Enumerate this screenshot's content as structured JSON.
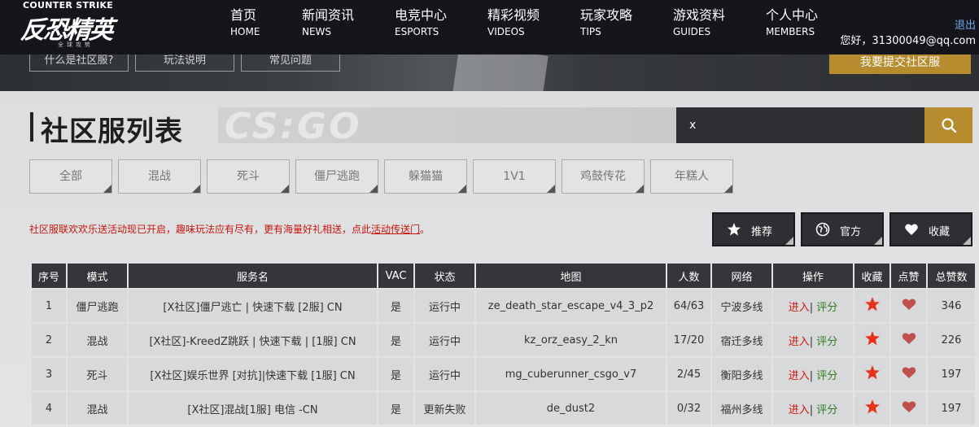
{
  "brand": {
    "en": "COUNTER STRIKE",
    "cn": "反恐精英",
    "sub": "全球攻势"
  },
  "nav": [
    {
      "cn": "首页",
      "en": "HOME"
    },
    {
      "cn": "新闻资讯",
      "en": "NEWS"
    },
    {
      "cn": "电竞中心",
      "en": "ESPORTS"
    },
    {
      "cn": "精彩视频",
      "en": "VIDEOS"
    },
    {
      "cn": "玩家攻略",
      "en": "TIPS"
    },
    {
      "cn": "游戏资料",
      "en": "GUIDES"
    },
    {
      "cn": "个人中心",
      "en": "MEMBERS"
    }
  ],
  "user": {
    "logout": "退出",
    "greeting": "您好，31300049@qq.com"
  },
  "banner": {
    "buttons": [
      "什么是社区服?",
      "玩法说明",
      "常见问题"
    ],
    "submit": "我要提交社区服"
  },
  "page": {
    "title": "社区服列表",
    "watermark": "CS:GO"
  },
  "search": {
    "value": "x"
  },
  "filters": [
    "全部",
    "混战",
    "死斗",
    "僵尸逃跑",
    "躲猫猫",
    "1V1",
    "鸡鼓传花",
    "年糕人"
  ],
  "notice": {
    "text": "社区服联欢欢乐送活动现已开启，趣味玩法应有尽有，更有海量好礼相送，点此",
    "link": "活动传送门",
    "end": "。"
  },
  "sort_buttons": [
    {
      "label": "推荐",
      "icon": "star-icon"
    },
    {
      "label": "官方",
      "icon": "globe-icon"
    },
    {
      "label": "收藏",
      "icon": "heart-icon"
    }
  ],
  "colors": {
    "accent": "#b68c2e",
    "running": "#2f7d1e",
    "failed": "#d4160c",
    "favorite": "#e8311b",
    "like": "#c0504d"
  },
  "table": {
    "headers": [
      "序号",
      "模式",
      "服务名",
      "VAC",
      "状态",
      "地图",
      "人数",
      "网络",
      "操作",
      "收藏",
      "点赞",
      "总赞数"
    ],
    "enter_label": "进入",
    "sep": "|",
    "rate_label": "评分",
    "rows": [
      {
        "no": "1",
        "mode": "僵尸逃跑",
        "name": "[X社区]僵尸逃亡 | 快速下载 [2服] CN",
        "vac": "是",
        "status": "运行中",
        "status_type": "running",
        "map": "ze_death_star_escape_v4_3_p2",
        "players": "64/63",
        "network": "宁波多线",
        "total": "346"
      },
      {
        "no": "2",
        "mode": "混战",
        "name": "[X社区]-KreedZ跳跃 | 快速下载 | [1服] CN",
        "vac": "是",
        "status": "运行中",
        "status_type": "running",
        "map": "kz_orz_easy_2_kn",
        "players": "17/20",
        "network": "宿迁多线",
        "total": "226"
      },
      {
        "no": "3",
        "mode": "死斗",
        "name": "[X社区]娱乐世界 [对抗]|快速下载 [1服] CN",
        "vac": "是",
        "status": "运行中",
        "status_type": "running",
        "map": "mg_cuberunner_csgo_v7",
        "players": "2/45",
        "network": "衡阳多线",
        "total": "197"
      },
      {
        "no": "4",
        "mode": "混战",
        "name": "[X社区]混战[1服] 电信 -CN",
        "vac": "是",
        "status": "更新失败",
        "status_type": "failed",
        "map": "de_dust2",
        "players": "0/32",
        "network": "福州多线",
        "total": "197"
      }
    ]
  }
}
